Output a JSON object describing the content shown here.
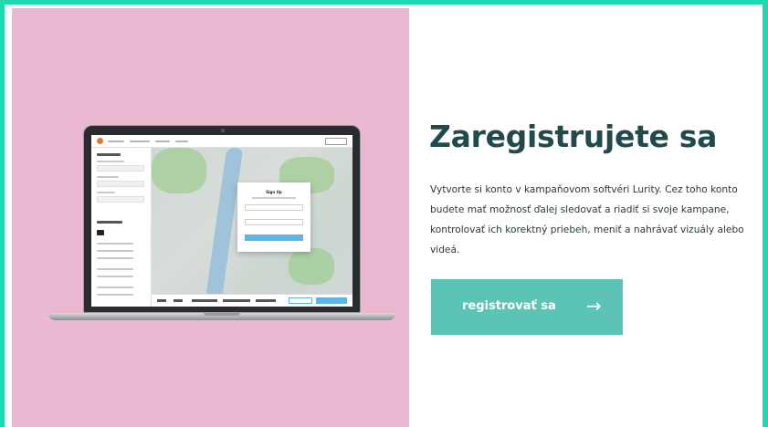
{
  "hero": {
    "heading": "Zaregistrujete sa",
    "paragraph": "Vytvorte si konto v kampaňovom softvéri Lurity. Cez toho konto budete mať možnosť ďalej sledovať a riadiť si svoje kampane, kontrolovať ich korektný priebeh, meniť a nahrávať vizuály alebo videá.",
    "cta_label": "registrovať sa",
    "cta_arrow": "→"
  },
  "mockup": {
    "signup_title": "Sign Up"
  },
  "colors": {
    "accent": "#1ed9b0",
    "panel": "#ebb8d1",
    "button": "#5cc3b7",
    "heading": "#234a4a"
  }
}
